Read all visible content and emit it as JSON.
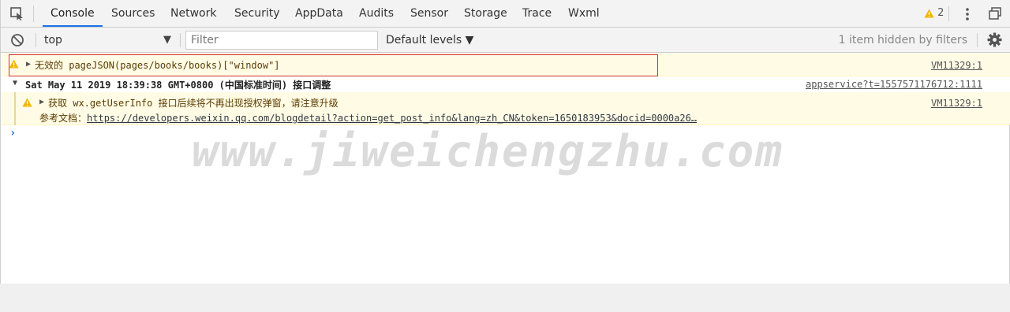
{
  "tabs": [
    {
      "label": "Console",
      "active": true
    },
    {
      "label": "Sources"
    },
    {
      "label": "Network"
    },
    {
      "label": "Security"
    },
    {
      "label": "AppData"
    },
    {
      "label": "Audits"
    },
    {
      "label": "Sensor"
    },
    {
      "label": "Storage"
    },
    {
      "label": "Trace"
    },
    {
      "label": "Wxml"
    }
  ],
  "tabbar": {
    "warning_count": "2"
  },
  "toolbar": {
    "context": "top",
    "filter_placeholder": "Filter",
    "levels": "Default levels ▼",
    "hidden_note": "1 item hidden by filters"
  },
  "messages": {
    "m1": {
      "text": "无效的 pageJSON(pages/books/books)[\"window\"]",
      "source": "VM11329:1"
    },
    "group": {
      "text": "Sat May 11 2019 18:39:38 GMT+0800 (中国标准时间) 接口调整",
      "source": "appservice?t=1557571176712:1111"
    },
    "m2": {
      "line1": "获取 wx.getUserInfo 接口后续将不再出现授权弹窗，请注意升级",
      "line2_prefix": "参考文档：",
      "link": "https://developers.weixin.qq.com/blogdetail?action=get_post_info&lang=zh_CN&token=1650183953&docid=0000a26…",
      "source": "VM11329:1"
    }
  },
  "watermark": "www.jiweichengzhu.com",
  "colors": {
    "accent": "#1a73e8",
    "warning": "#f4b400",
    "highlight": "#d32f2f"
  }
}
